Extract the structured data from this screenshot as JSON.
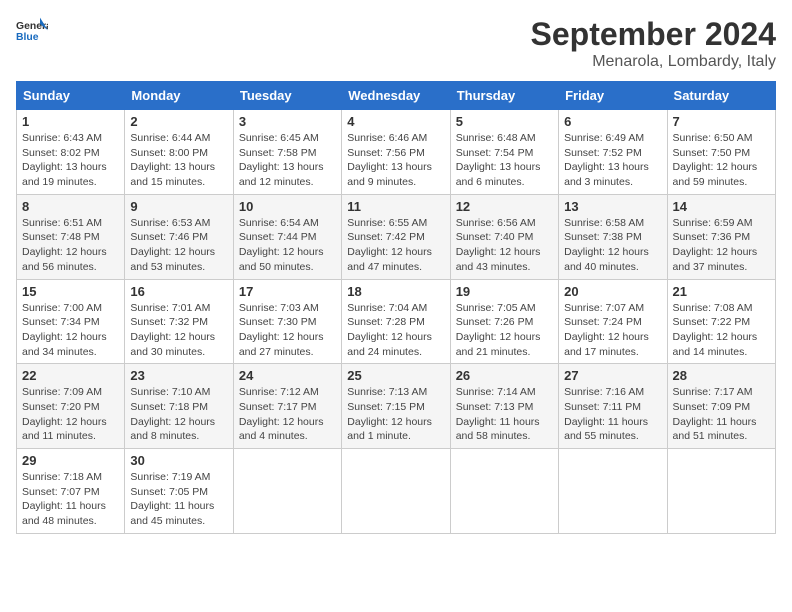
{
  "logo": {
    "general": "General",
    "blue": "Blue"
  },
  "title": "September 2024",
  "location": "Menarola, Lombardy, Italy",
  "weekdays": [
    "Sunday",
    "Monday",
    "Tuesday",
    "Wednesday",
    "Thursday",
    "Friday",
    "Saturday"
  ],
  "weeks": [
    [
      {
        "day": "1",
        "sunrise": "6:43 AM",
        "sunset": "8:02 PM",
        "daylight": "13 hours and 19 minutes."
      },
      {
        "day": "2",
        "sunrise": "6:44 AM",
        "sunset": "8:00 PM",
        "daylight": "13 hours and 15 minutes."
      },
      {
        "day": "3",
        "sunrise": "6:45 AM",
        "sunset": "7:58 PM",
        "daylight": "13 hours and 12 minutes."
      },
      {
        "day": "4",
        "sunrise": "6:46 AM",
        "sunset": "7:56 PM",
        "daylight": "13 hours and 9 minutes."
      },
      {
        "day": "5",
        "sunrise": "6:48 AM",
        "sunset": "7:54 PM",
        "daylight": "13 hours and 6 minutes."
      },
      {
        "day": "6",
        "sunrise": "6:49 AM",
        "sunset": "7:52 PM",
        "daylight": "13 hours and 3 minutes."
      },
      {
        "day": "7",
        "sunrise": "6:50 AM",
        "sunset": "7:50 PM",
        "daylight": "12 hours and 59 minutes."
      }
    ],
    [
      {
        "day": "8",
        "sunrise": "6:51 AM",
        "sunset": "7:48 PM",
        "daylight": "12 hours and 56 minutes."
      },
      {
        "day": "9",
        "sunrise": "6:53 AM",
        "sunset": "7:46 PM",
        "daylight": "12 hours and 53 minutes."
      },
      {
        "day": "10",
        "sunrise": "6:54 AM",
        "sunset": "7:44 PM",
        "daylight": "12 hours and 50 minutes."
      },
      {
        "day": "11",
        "sunrise": "6:55 AM",
        "sunset": "7:42 PM",
        "daylight": "12 hours and 47 minutes."
      },
      {
        "day": "12",
        "sunrise": "6:56 AM",
        "sunset": "7:40 PM",
        "daylight": "12 hours and 43 minutes."
      },
      {
        "day": "13",
        "sunrise": "6:58 AM",
        "sunset": "7:38 PM",
        "daylight": "12 hours and 40 minutes."
      },
      {
        "day": "14",
        "sunrise": "6:59 AM",
        "sunset": "7:36 PM",
        "daylight": "12 hours and 37 minutes."
      }
    ],
    [
      {
        "day": "15",
        "sunrise": "7:00 AM",
        "sunset": "7:34 PM",
        "daylight": "12 hours and 34 minutes."
      },
      {
        "day": "16",
        "sunrise": "7:01 AM",
        "sunset": "7:32 PM",
        "daylight": "12 hours and 30 minutes."
      },
      {
        "day": "17",
        "sunrise": "7:03 AM",
        "sunset": "7:30 PM",
        "daylight": "12 hours and 27 minutes."
      },
      {
        "day": "18",
        "sunrise": "7:04 AM",
        "sunset": "7:28 PM",
        "daylight": "12 hours and 24 minutes."
      },
      {
        "day": "19",
        "sunrise": "7:05 AM",
        "sunset": "7:26 PM",
        "daylight": "12 hours and 21 minutes."
      },
      {
        "day": "20",
        "sunrise": "7:07 AM",
        "sunset": "7:24 PM",
        "daylight": "12 hours and 17 minutes."
      },
      {
        "day": "21",
        "sunrise": "7:08 AM",
        "sunset": "7:22 PM",
        "daylight": "12 hours and 14 minutes."
      }
    ],
    [
      {
        "day": "22",
        "sunrise": "7:09 AM",
        "sunset": "7:20 PM",
        "daylight": "12 hours and 11 minutes."
      },
      {
        "day": "23",
        "sunrise": "7:10 AM",
        "sunset": "7:18 PM",
        "daylight": "12 hours and 8 minutes."
      },
      {
        "day": "24",
        "sunrise": "7:12 AM",
        "sunset": "7:17 PM",
        "daylight": "12 hours and 4 minutes."
      },
      {
        "day": "25",
        "sunrise": "7:13 AM",
        "sunset": "7:15 PM",
        "daylight": "12 hours and 1 minute."
      },
      {
        "day": "26",
        "sunrise": "7:14 AM",
        "sunset": "7:13 PM",
        "daylight": "11 hours and 58 minutes."
      },
      {
        "day": "27",
        "sunrise": "7:16 AM",
        "sunset": "7:11 PM",
        "daylight": "11 hours and 55 minutes."
      },
      {
        "day": "28",
        "sunrise": "7:17 AM",
        "sunset": "7:09 PM",
        "daylight": "11 hours and 51 minutes."
      }
    ],
    [
      {
        "day": "29",
        "sunrise": "7:18 AM",
        "sunset": "7:07 PM",
        "daylight": "11 hours and 48 minutes."
      },
      {
        "day": "30",
        "sunrise": "7:19 AM",
        "sunset": "7:05 PM",
        "daylight": "11 hours and 45 minutes."
      },
      null,
      null,
      null,
      null,
      null
    ]
  ],
  "labels": {
    "sunrise": "Sunrise:",
    "sunset": "Sunset:",
    "daylight": "Daylight:"
  }
}
